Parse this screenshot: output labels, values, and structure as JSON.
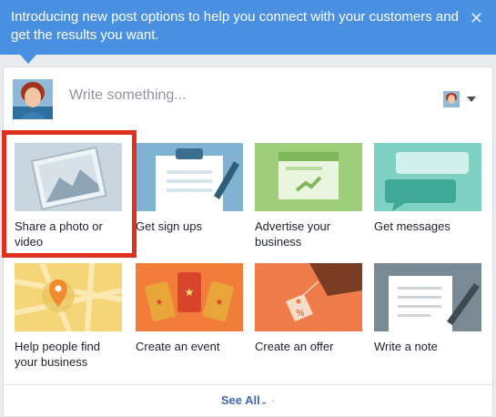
{
  "banner": {
    "text": "Introducing new post options to help you connect with your customers and get the results you want.",
    "close_glyph": "✕"
  },
  "composer": {
    "placeholder": "Write something..."
  },
  "tiles": [
    {
      "label": "Share a photo or video",
      "icon": "photo-icon"
    },
    {
      "label": "Get sign ups",
      "icon": "clipboard-icon"
    },
    {
      "label": "Advertise your business",
      "icon": "ad-browser-icon"
    },
    {
      "label": "Get messages",
      "icon": "chat-bubbles-icon"
    },
    {
      "label": "Help people find your business",
      "icon": "map-pin-icon"
    },
    {
      "label": "Create an event",
      "icon": "ticket-icon"
    },
    {
      "label": "Create an offer",
      "icon": "price-tag-icon"
    },
    {
      "label": "Write a note",
      "icon": "note-icon"
    }
  ],
  "footer": {
    "see_all": "See All",
    "chevron": "⌄",
    "dot": "·"
  },
  "colors": {
    "banner": "#4a90e2",
    "highlight": "#e0301e",
    "link": "#4267b2"
  }
}
